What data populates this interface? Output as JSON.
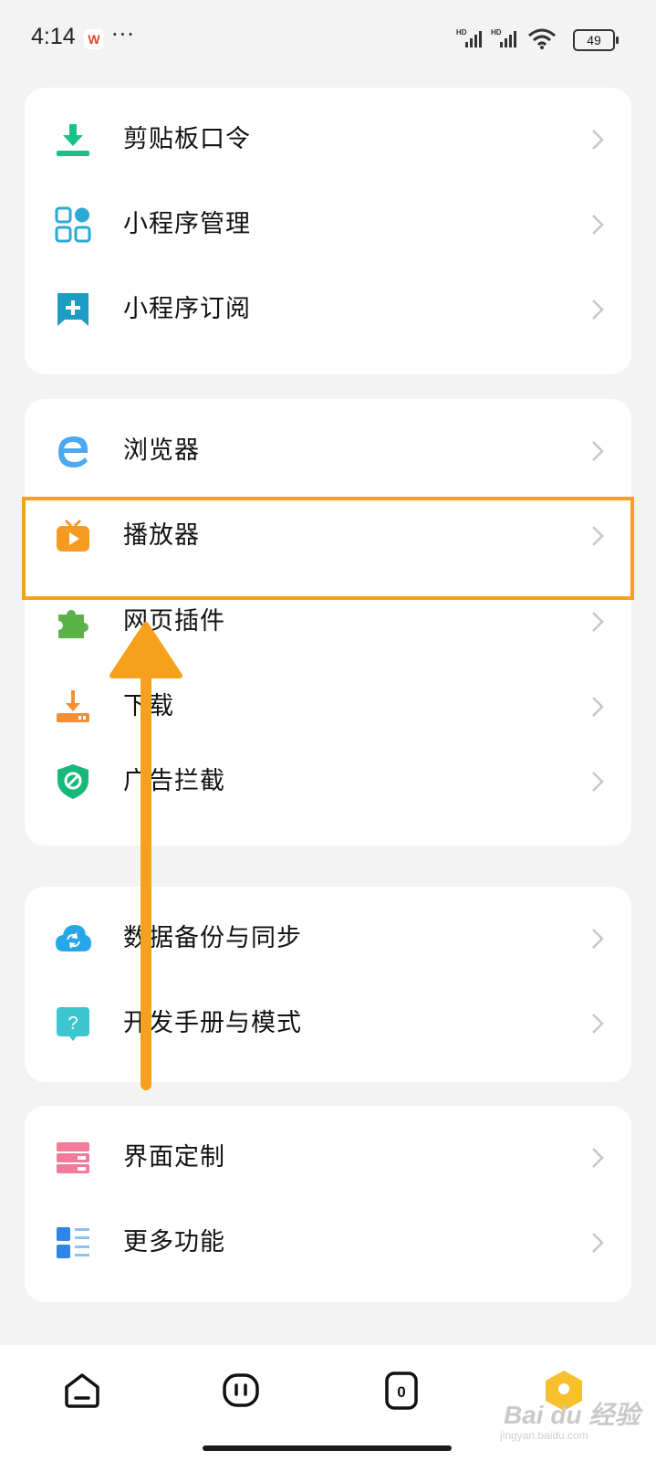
{
  "status_bar": {
    "time": "4:14",
    "app_badge": "W",
    "more": "···",
    "signal_1_label": "HD",
    "signal_2_label": "HD",
    "battery": "49"
  },
  "sections": [
    {
      "items": [
        {
          "label": "剪贴板口令",
          "icon": "clipboard-download-icon",
          "color": "#1bbf8a"
        },
        {
          "label": "小程序管理",
          "icon": "grid-apps-icon",
          "color": "#2aa9d2"
        },
        {
          "label": "小程序订阅",
          "icon": "bookmark-plus-icon",
          "color": "#1e9cc4"
        }
      ]
    },
    {
      "items": [
        {
          "label": "浏览器",
          "icon": "browser-e-icon",
          "color": "#4aa9f0"
        },
        {
          "label": "播放器",
          "icon": "tv-play-icon",
          "color": "#f59a23"
        },
        {
          "label": "网页插件",
          "icon": "puzzle-icon",
          "color": "#5bb347"
        },
        {
          "label": "下载",
          "icon": "download-tray-icon",
          "color": "#f2903a"
        },
        {
          "label": "广告拦截",
          "icon": "shield-block-icon",
          "color": "#16b97a"
        }
      ]
    },
    {
      "items": [
        {
          "label": "数据备份与同步",
          "icon": "cloud-sync-icon",
          "color": "#27a6e8"
        },
        {
          "label": "开发手册与模式",
          "icon": "help-bubble-icon",
          "color": "#3cc6cf"
        }
      ]
    },
    {
      "items": [
        {
          "label": "界面定制",
          "icon": "layout-custom-icon",
          "color": "#f27a9b"
        },
        {
          "label": "更多功能",
          "icon": "list-more-icon",
          "color": "#2f86e8"
        }
      ]
    }
  ],
  "bottom_nav": {
    "tabs": [
      {
        "icon": "home-icon"
      },
      {
        "icon": "chat-icon"
      },
      {
        "icon": "tabs-count-icon",
        "count": "0"
      },
      {
        "icon": "profile-icon"
      }
    ]
  },
  "watermark": {
    "brand": "Bai du 经验",
    "url": "jingyan.baidu.com"
  },
  "annotation": {
    "color": "#f5a11d",
    "highlighted_item": "播放器"
  }
}
